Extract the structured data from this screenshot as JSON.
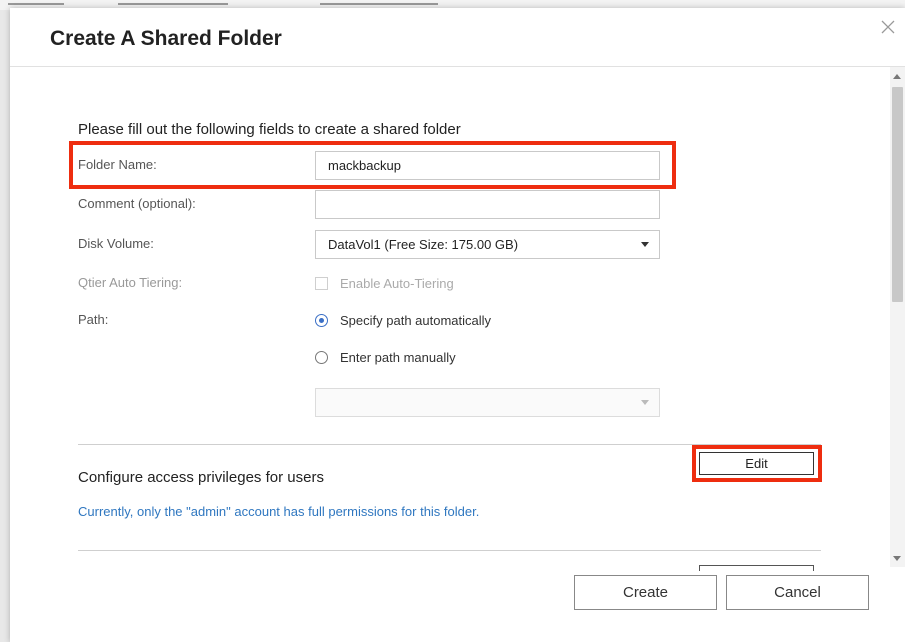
{
  "dialog": {
    "title": "Create A Shared Folder",
    "close_icon": "close-icon"
  },
  "form": {
    "heading": "Please fill out the following fields to create a shared folder",
    "folder_name": {
      "label": "Folder Name:",
      "value": "mackbackup"
    },
    "comment": {
      "label": "Comment (optional):",
      "value": ""
    },
    "disk_volume": {
      "label": "Disk Volume:",
      "value": "DataVol1 (Free Size: 175.00 GB)"
    },
    "qtier": {
      "label": "Qtier Auto Tiering:",
      "checkbox_label": "Enable Auto-Tiering",
      "checked": false
    },
    "path": {
      "label": "Path:",
      "option_auto": "Specify path automatically",
      "option_manual": "Enter path manually",
      "selected": "auto",
      "manual_value": ""
    }
  },
  "privileges": {
    "heading": "Configure access privileges for users",
    "edit_label": "Edit",
    "info": "Currently, only the \"admin\" account has full permissions for this folder."
  },
  "footer": {
    "create_label": "Create",
    "cancel_label": "Cancel"
  },
  "colors": {
    "highlight": "#ee2d0f",
    "link": "#2f77c0",
    "radio_selected": "#3a6fc6"
  }
}
